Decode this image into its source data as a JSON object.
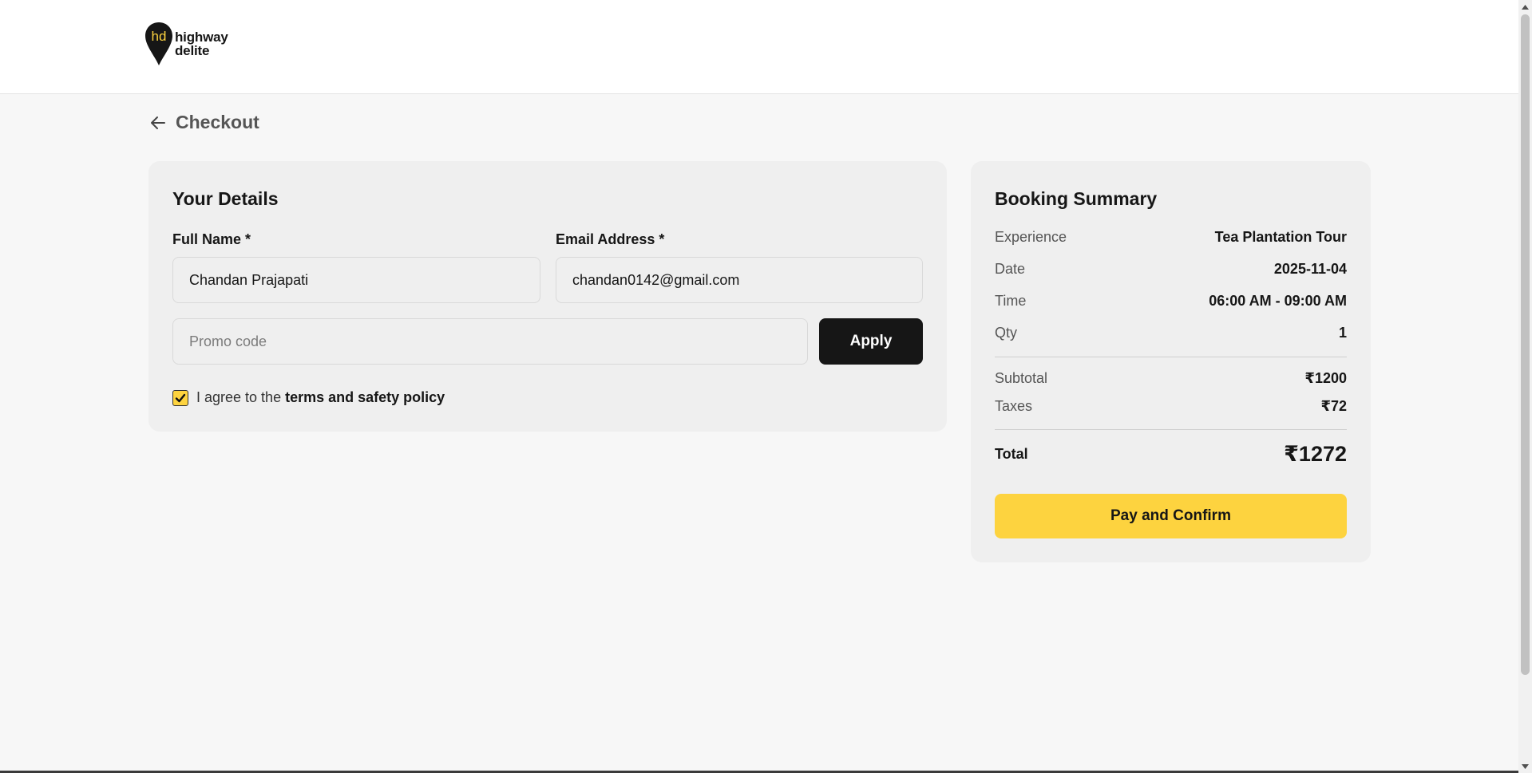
{
  "brand": {
    "logo_mark": "hd",
    "line1": "highway",
    "line2": "delite"
  },
  "page": {
    "title": "Checkout",
    "back_icon": "arrow-left-icon"
  },
  "details": {
    "title": "Your Details",
    "full_name_label": "Full Name *",
    "full_name_value": "Chandan Prajapati",
    "email_label": "Email Address *",
    "email_value": "chandan0142@gmail.com",
    "promo_placeholder": "Promo code",
    "apply_label": "Apply",
    "agree_prefix": "I agree to the",
    "agree_link": "terms and safety policy",
    "agree_checked": true
  },
  "summary": {
    "title": "Booking Summary",
    "rows": [
      {
        "label": "Experience",
        "value": "Tea Plantation Tour"
      },
      {
        "label": "Date",
        "value": "2025-11-04"
      },
      {
        "label": "Time",
        "value": "06:00 AM - 09:00 AM"
      },
      {
        "label": "Qty",
        "value": "1"
      }
    ],
    "subtotal_label": "Subtotal",
    "subtotal_value": "₹1200",
    "taxes_label": "Taxes",
    "taxes_value": "₹72",
    "total_label": "Total",
    "total_value": "₹1272",
    "pay_label": "Pay and Confirm"
  },
  "colors": {
    "accent": "#fdd33f",
    "dark": "#161616",
    "card_bg": "#efefef",
    "page_bg": "#f7f7f7"
  }
}
